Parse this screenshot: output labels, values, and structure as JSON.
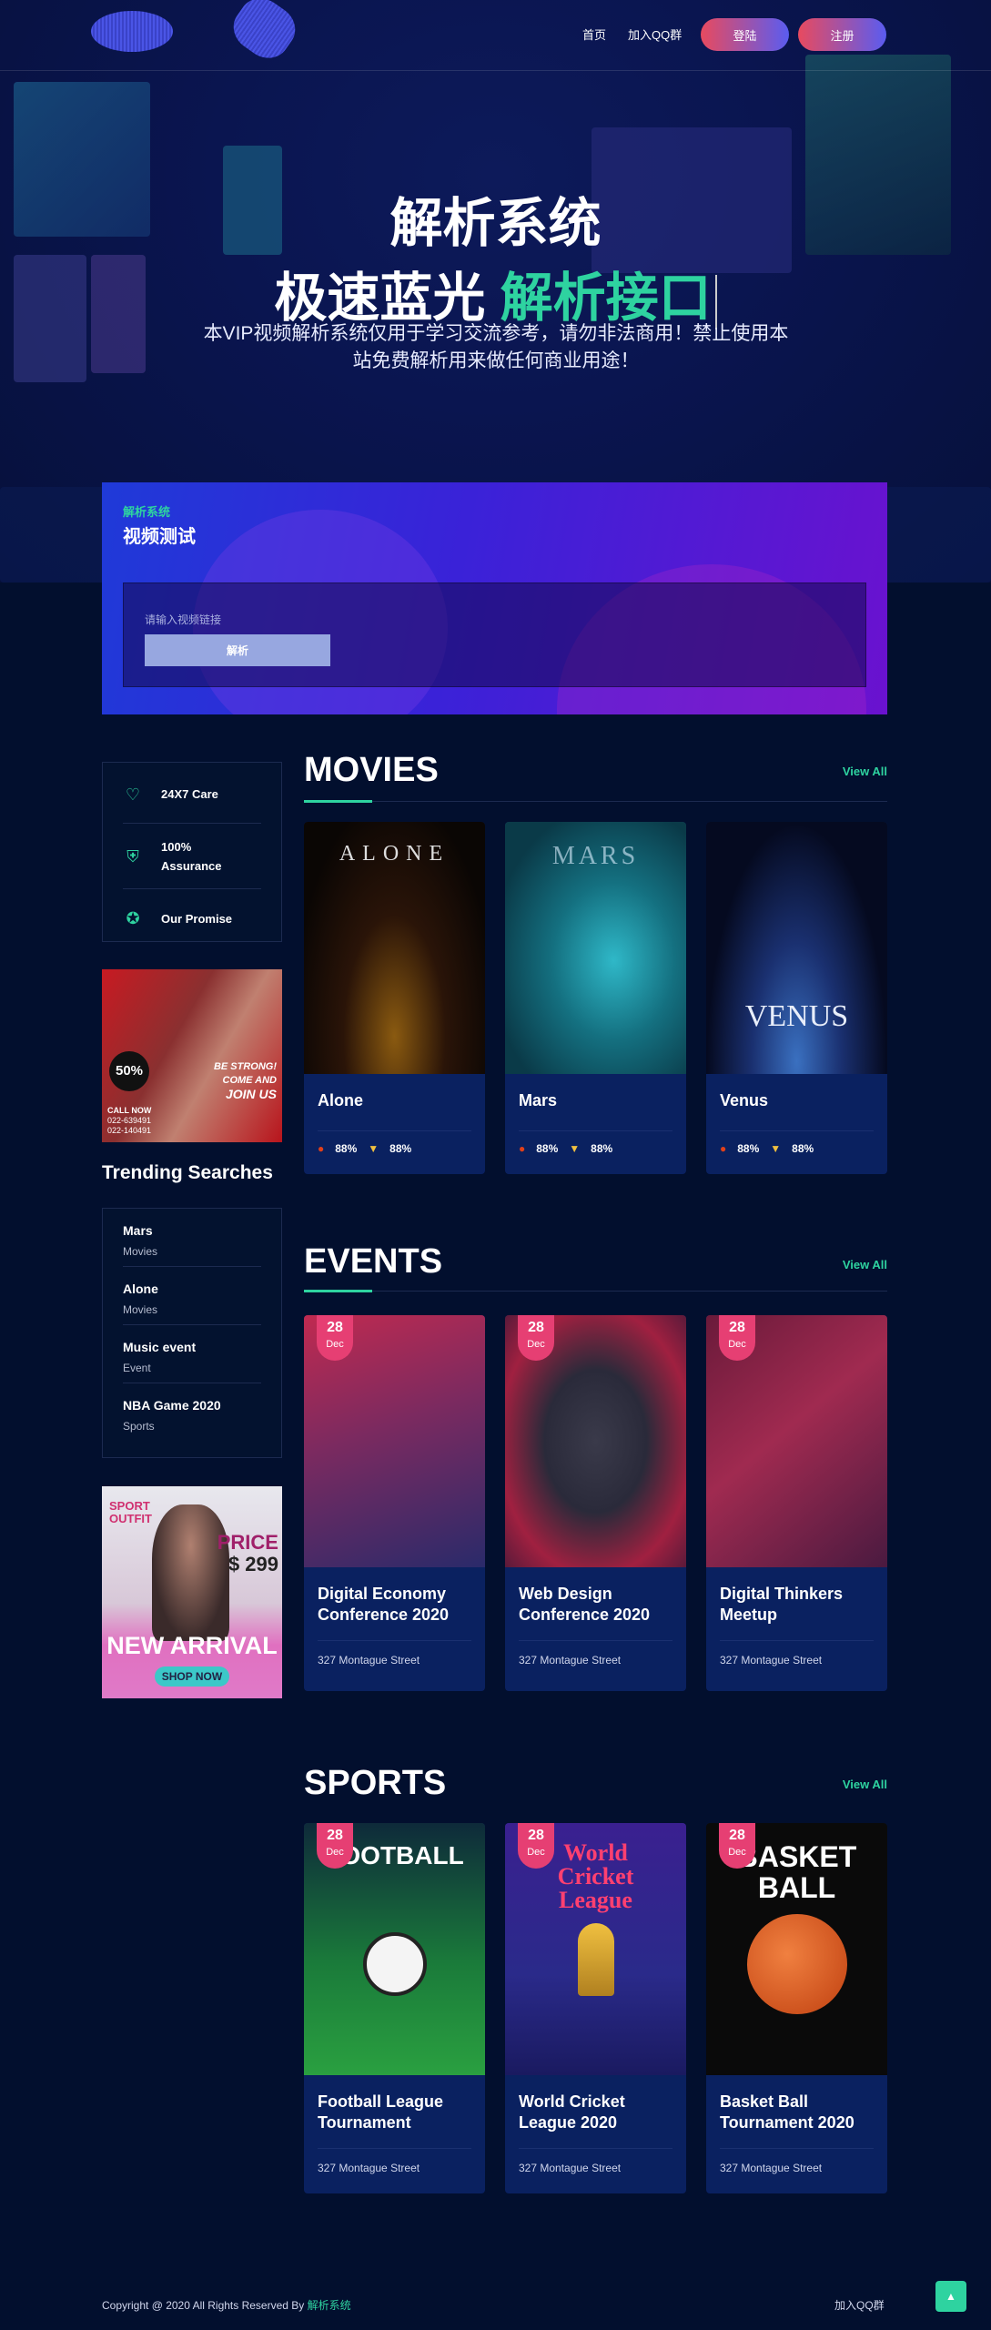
{
  "nav": {
    "home": "首页",
    "qq_group": "加入QQ群",
    "login": "登陆",
    "register": "注册"
  },
  "hero": {
    "title": "解析系统",
    "subtitle_white": "极速蓝光",
    "subtitle_green": "解析接口",
    "description": "本VIP视频解析系统仅用于学习交流参考，请勿非法商用！禁止使用本站免费解析用来做任何商业用途！"
  },
  "parse_panel": {
    "kicker": "解析系统",
    "heading": "视频测试",
    "input_placeholder": "请输入视频链接",
    "button": "解析"
  },
  "features": [
    {
      "icon": "heart-hand-icon",
      "label": "24X7 Care"
    },
    {
      "icon": "shield-person-icon",
      "label": "100% Assurance"
    },
    {
      "icon": "award-ribbon-icon",
      "label": "Our Promise"
    }
  ],
  "ads": {
    "gym": {
      "discount": "50%",
      "line1": "BE STRONG!",
      "line2": "COME AND",
      "line3": "JOIN US",
      "call": "CALL NOW",
      "phone1": "022-639491",
      "phone2": "022-140491"
    },
    "fashion": {
      "tag": "SPORT OUTFIT",
      "price_label": "PRICE",
      "price": "$ 299",
      "headline": "NEW ARRIVAL",
      "cta": "SHOP NOW"
    }
  },
  "trending": {
    "title": "Trending Searches",
    "items": [
      {
        "name": "Mars",
        "category": "Movies"
      },
      {
        "name": "Alone",
        "category": "Movies"
      },
      {
        "name": "Music event",
        "category": "Event"
      },
      {
        "name": "NBA Game 2020",
        "category": "Sports"
      }
    ]
  },
  "movies": {
    "title": "MOVIES",
    "view_all": "View All",
    "items": [
      {
        "title": "Alone",
        "poster_text": "ALONE",
        "tomato": "88%",
        "popcorn": "88%"
      },
      {
        "title": "Mars",
        "poster_text": "MARS",
        "tomato": "88%",
        "popcorn": "88%"
      },
      {
        "title": "Venus",
        "poster_text": "VENUS",
        "tomato": "88%",
        "popcorn": "88%"
      }
    ]
  },
  "events": {
    "title": "EVENTS",
    "view_all": "View All",
    "items": [
      {
        "day": "28",
        "month": "Dec",
        "title": "Digital Economy Conference 2020",
        "address": "327 Montague Street"
      },
      {
        "day": "28",
        "month": "Dec",
        "title": "Web Design Conference 2020",
        "address": "327 Montague Street"
      },
      {
        "day": "28",
        "month": "Dec",
        "title": "Digital Thinkers Meetup",
        "address": "327 Montague Street"
      }
    ]
  },
  "sports": {
    "title": "SPORTS",
    "view_all": "View All",
    "items": [
      {
        "day": "28",
        "month": "Dec",
        "title": "Football League Tournament",
        "poster_text": "FOOTBALL",
        "address": "327 Montague Street"
      },
      {
        "day": "28",
        "month": "Dec",
        "title": "World Cricket League 2020",
        "poster_text": "World Cricket League",
        "address": "327 Montague Street"
      },
      {
        "day": "28",
        "month": "Dec",
        "title": "Basket Ball Tournament 2020",
        "poster_text": "BASKET BALL",
        "address": "327 Montague Street"
      }
    ]
  },
  "footer": {
    "copyright": "Copyright @ 2020 All Rights Reserved By ",
    "brand": "解析系统",
    "qq_group": "加入QQ群",
    "top_icon": "chevron-up-icon"
  },
  "colors": {
    "accent": "#2ed3a0",
    "background": "#020f2e",
    "card": "#0a2160",
    "date_badge": "#e63f73"
  }
}
